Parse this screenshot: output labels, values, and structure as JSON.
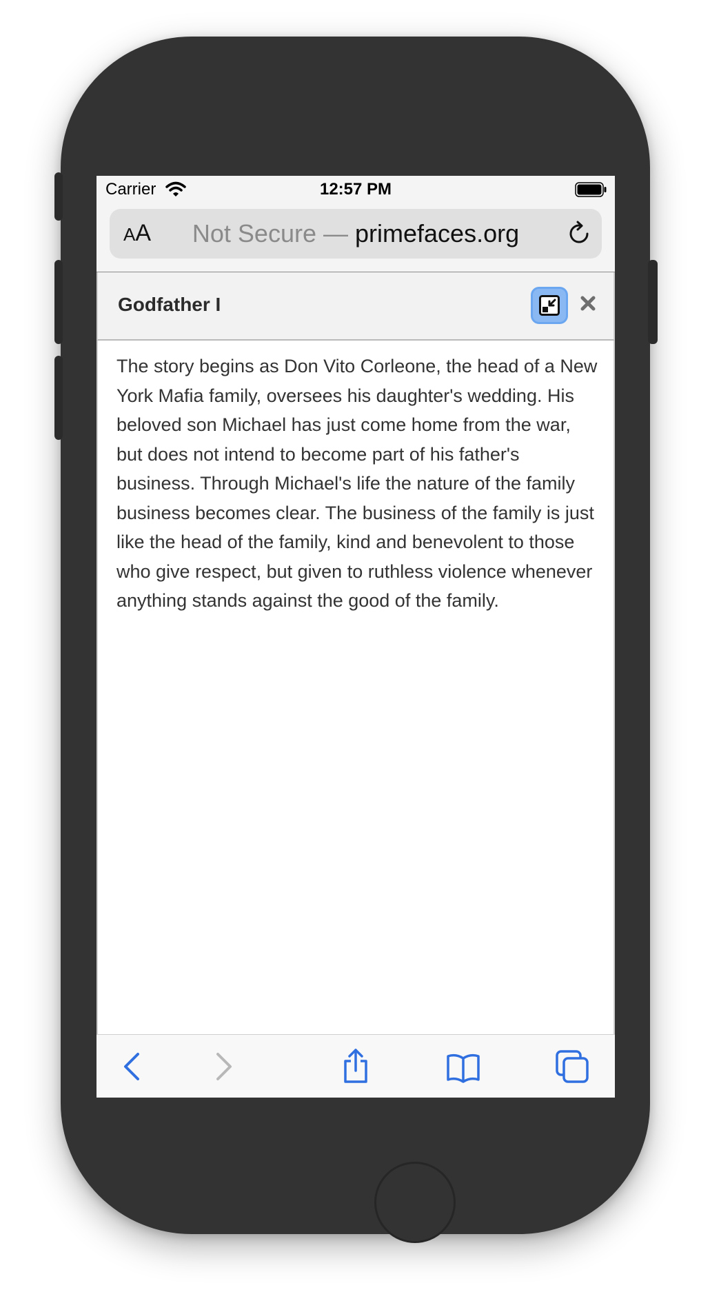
{
  "status_bar": {
    "carrier": "Carrier",
    "time": "12:57 PM"
  },
  "address_bar": {
    "text_size_button": "AA",
    "security_label": "Not Secure —",
    "domain": "primefaces.org"
  },
  "dialog": {
    "title": "Godfather I",
    "body": "The story begins as Don Vito Corleone, the head of a New York Mafia family, oversees his daughter's wedding. His beloved son Michael has just come home from the war, but does not intend to become part of his father's business. Through Michael's life the nature of the family business becomes clear. The business of the family is just like the head of the family, kind and benevolent to those who give respect, but given to ruthless violence whenever anything stands against the good of the family."
  },
  "toolbar": {
    "buttons": [
      "back-icon",
      "forward-icon",
      "share-icon",
      "bookmarks-icon",
      "tabs-icon"
    ]
  },
  "colors": {
    "accent": "#2f6fe0",
    "frame": "#333333",
    "minimize_button": "#8ab8f3"
  }
}
